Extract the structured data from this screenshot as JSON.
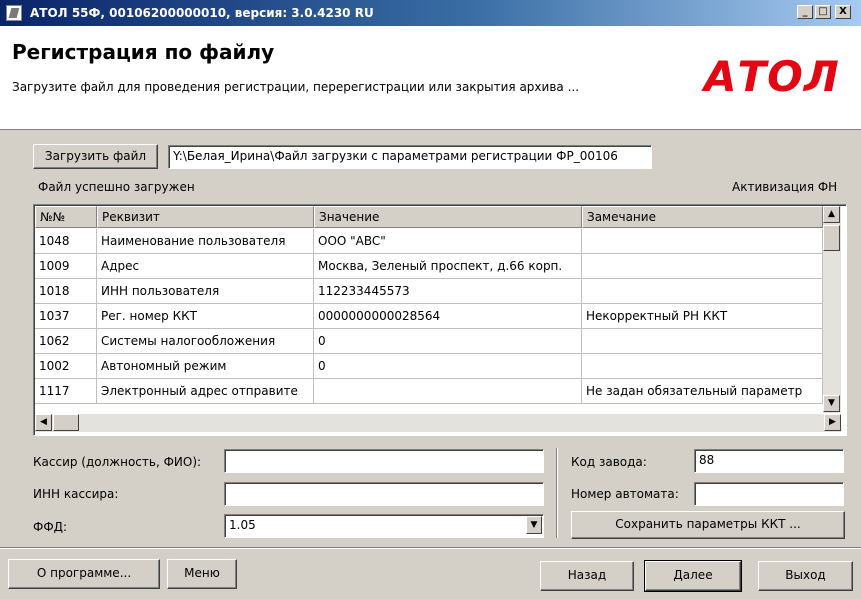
{
  "window": {
    "title": "АТОЛ 55Ф, 00106200000010, версия: 3.0.4230 RU",
    "minimize_glyph": "_",
    "maximize_glyph": "□",
    "close_glyph": "X"
  },
  "header": {
    "title": "Регистрация по файлу",
    "subtitle": "Загрузите файл для проведения регистрации, перерегистрации или закрытия архива ...",
    "logo": "АТОЛ"
  },
  "file": {
    "load_button": "Загрузить файл",
    "path": "Y:\\Белая_Ирина\\Файл загрузки с параметрами регистрации ФР_00106",
    "status": "Файл успешно загружен",
    "activation": "Активизация ФН"
  },
  "table": {
    "columns": [
      "№№",
      "Реквизит",
      "Значение",
      "Замечание"
    ],
    "rows": [
      [
        "1048",
        "Наименование пользователя",
        "ООО \"ABC\"",
        ""
      ],
      [
        "1009",
        "Адрес",
        "Москва, Зеленый проспект, д.66 корп.",
        ""
      ],
      [
        "1018",
        "ИНН пользователя",
        "112233445573",
        ""
      ],
      [
        "1037",
        "Рег. номер ККТ",
        "0000000000028564",
        "Некорректный РН ККТ"
      ],
      [
        "1062",
        "Системы налогообложения",
        "0",
        ""
      ],
      [
        "1002",
        "Автономный режим",
        "0",
        ""
      ],
      [
        "1117",
        "Электронный адрес отправите",
        "",
        "Не задан обязательный параметр"
      ]
    ]
  },
  "form": {
    "cashier_label": "Кассир (должность, ФИО):",
    "cashier_value": "",
    "cashier_inn_label": "ИНН кассира:",
    "cashier_inn_value": "",
    "ffd_label": "ФФД:",
    "ffd_value": "1.05",
    "factory_code_label": "Код завода:",
    "factory_code_value": "88",
    "machine_number_label": "Номер автомата:",
    "machine_number_value": "",
    "save_button": "Сохранить параметры ККТ ..."
  },
  "footer": {
    "about_button": "О программе...",
    "menu_button": "Меню",
    "back_button": "Назад",
    "next_button": "Далее",
    "exit_button": "Выход"
  },
  "colors": {
    "logo": "#e30613",
    "titlebar_start": "#0a246a",
    "titlebar_end": "#a6caf0",
    "window_bg": "#d4d0c8"
  }
}
